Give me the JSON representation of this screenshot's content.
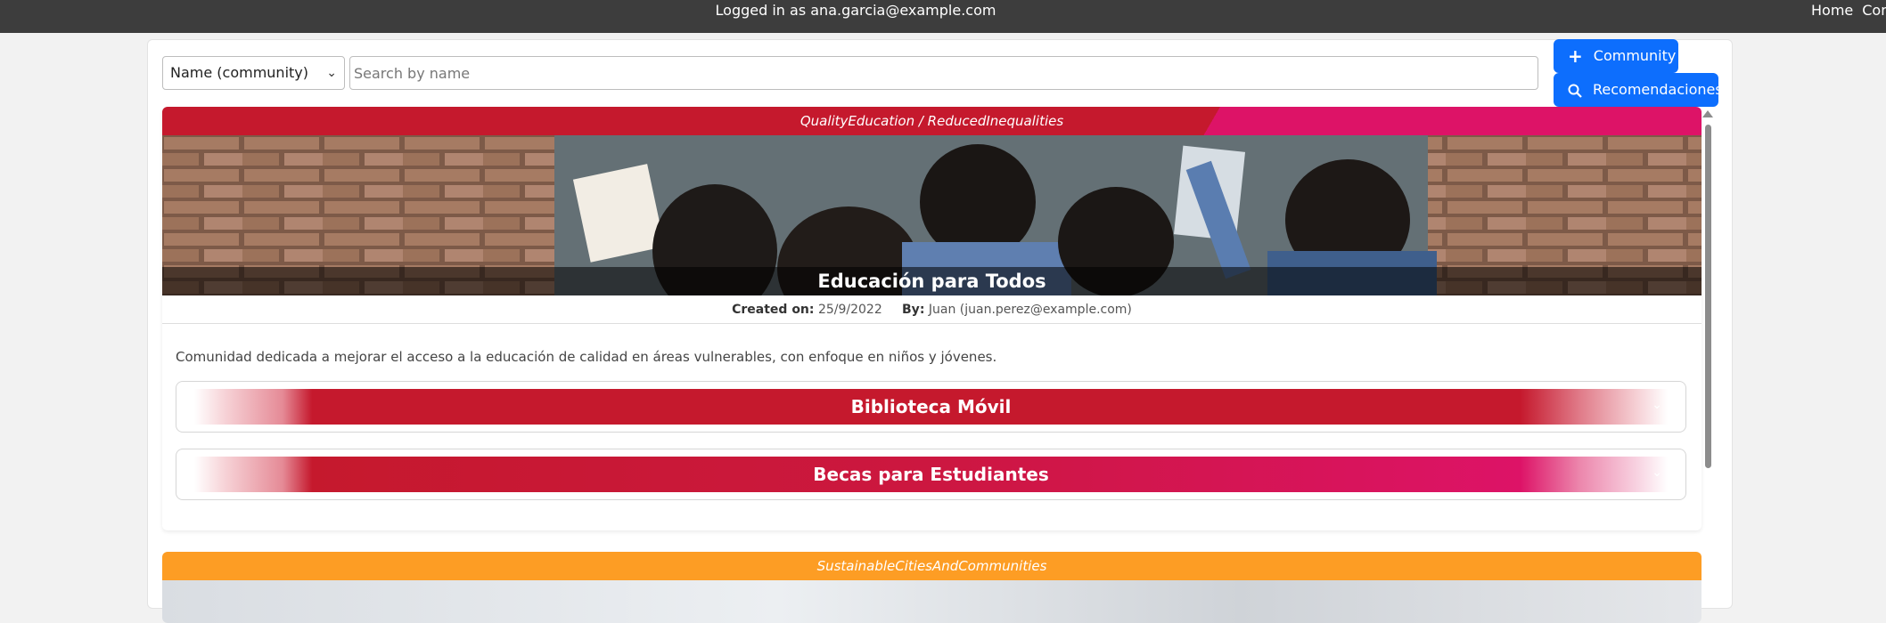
{
  "topbar": {
    "logged_in": "Logged in as ana.garcia@example.com",
    "nav": [
      "Home",
      "Con"
    ]
  },
  "filter": {
    "select_value": "Name (community)",
    "search_placeholder": "Search by name"
  },
  "actions": {
    "community_label": "Community",
    "recommend_label": "Recomendaciones"
  },
  "communities": [
    {
      "tags": "QualityEducation / ReducedInequalities",
      "title": "Educación para Todos",
      "created_label": "Created on:",
      "created_value": "25/9/2022",
      "by_label": "By:",
      "by_value": "Juan (juan.perez@example.com)",
      "description": "Comunidad dedicada a mejorar el acceso a la educación de calidad en áreas vulnerables, con enfoque en niños y jóvenes.",
      "projects": [
        "Biblioteca Móvil",
        "Becas para Estudiantes"
      ],
      "colors": {
        "band_primary": "#c5192d",
        "band_secondary": "#dd1367"
      }
    },
    {
      "tags": "SustainableCitiesAndCommunities",
      "colors": {
        "band_primary": "#fd9d24"
      }
    }
  ]
}
